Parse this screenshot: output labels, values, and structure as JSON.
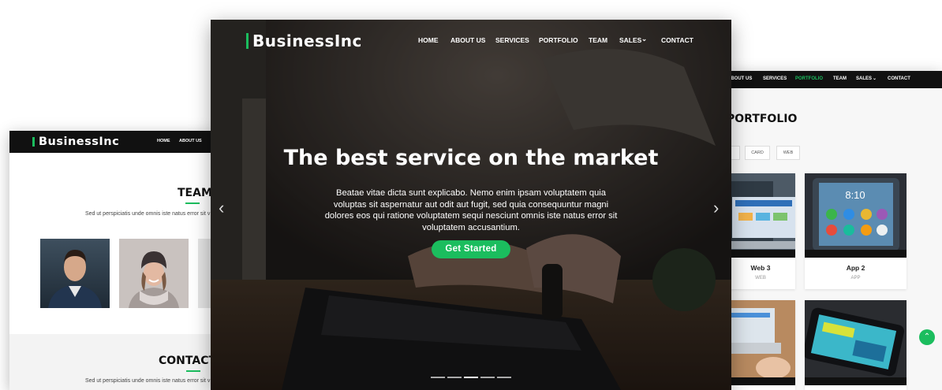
{
  "left": {
    "brand": "BusinessInc",
    "nav": [
      "HOME",
      "ABOUT US"
    ],
    "team_title": "TEAM",
    "team_lead": "Sed ut perspiciatis unde omnis iste natus error sit v",
    "contact_title": "CONTACT",
    "contact_lead": "Sed ut perspiciatis unde omnis iste natus error sit v"
  },
  "center": {
    "brand": "BusinessInc",
    "nav": [
      "HOME",
      "ABOUT US",
      "SERVICES",
      "PORTFOLIO",
      "TEAM",
      "SALES",
      "CONTACT"
    ],
    "hero_title": "The best service on the market",
    "hero_text": "Beatae vitae dicta sunt explicabo. Nemo enim ipsam voluptatem quia voluptas sit aspernatur aut odit aut fugit, sed quia consequuntur magni dolores eos qui ratione voluptatem sequi nesciunt omnis iste natus error sit voluptatem accusantium.",
    "cta_label": "Get Started",
    "prev_arrow": "‹",
    "next_arrow": "›",
    "slide_count": 5,
    "active_slide": 3
  },
  "right": {
    "nav": [
      "ABOUT US",
      "SERVICES",
      "PORTFOLIO",
      "TEAM",
      "SALES",
      "CONTACT"
    ],
    "active_nav": "PORTFOLIO",
    "section_title": "PORTFOLIO",
    "filters": [
      "CARD",
      "WEB"
    ],
    "cards": [
      {
        "title": "Web 3",
        "sub": "WEB"
      },
      {
        "title": "App 2",
        "sub": "APP"
      }
    ]
  },
  "colors": {
    "accent": "#1bbd5e",
    "dark_nav": "#111111"
  },
  "scroll_top_icon": "chevron-up-icon"
}
